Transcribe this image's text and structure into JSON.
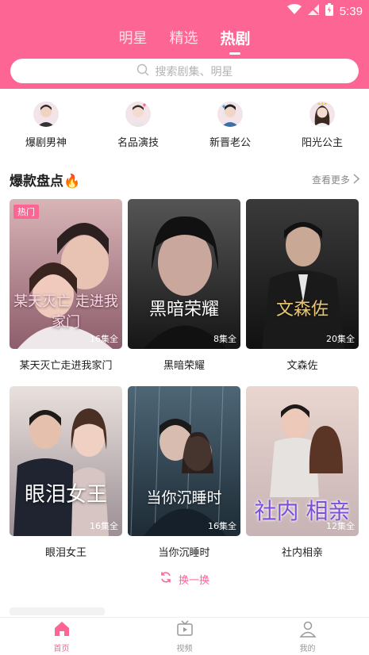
{
  "status": {
    "time": "5:39"
  },
  "tabs": [
    {
      "label": "明星",
      "active": false
    },
    {
      "label": "精选",
      "active": false
    },
    {
      "label": "热剧",
      "active": true
    }
  ],
  "search": {
    "placeholder": "搜索剧集、明星"
  },
  "categories": [
    {
      "label": "爆剧男神"
    },
    {
      "label": "名品演技"
    },
    {
      "label": "新晋老公"
    },
    {
      "label": "阳光公主"
    }
  ],
  "section": {
    "title": "爆款盘点🔥",
    "more": "查看更多"
  },
  "cards": [
    {
      "title": "某天灭亡走进我家门",
      "episodes": "16集全",
      "badge": "热门",
      "poster_text": "某天灭亡 走进我家门",
      "color_top": "#d8b5b7",
      "color_bottom": "#8d5d6b"
    },
    {
      "title": "黑暗荣耀",
      "episodes": "8集全",
      "badge": "",
      "poster_text": "黑暗荣耀",
      "color_top": "#555555",
      "color_bottom": "#161616"
    },
    {
      "title": "文森佐",
      "episodes": "20集全",
      "badge": "",
      "poster_text": "文森佐",
      "color_top": "#3a3a3a",
      "color_bottom": "#111111"
    },
    {
      "title": "眼泪女王",
      "episodes": "16集全",
      "badge": "",
      "poster_text": "眼泪女王",
      "color_top": "#e9e1dd",
      "color_bottom": "#9c8f95"
    },
    {
      "title": "当你沉睡时",
      "episodes": "16集全",
      "badge": "",
      "poster_text": "当你沉睡时",
      "color_top": "#4e6676",
      "color_bottom": "#1d2b35"
    },
    {
      "title": "社内相亲",
      "episodes": "12集全",
      "badge": "",
      "poster_text": "社内 相亲",
      "color_top": "#e9d6cf",
      "color_bottom": "#c7b3b5"
    }
  ],
  "refresh": {
    "label": "换一换"
  },
  "bottom_nav": [
    {
      "label": "首页",
      "active": true
    },
    {
      "label": "视频",
      "active": false
    },
    {
      "label": "我的",
      "active": false
    }
  ],
  "colors": {
    "accent": "#fc6594"
  }
}
